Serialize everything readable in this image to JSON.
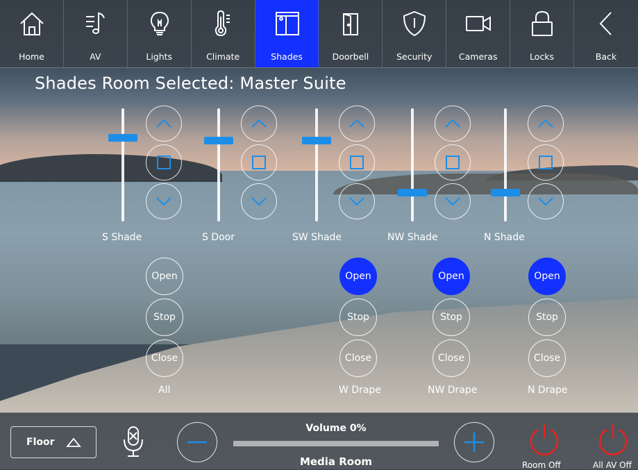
{
  "nav": {
    "items": [
      {
        "label": "Home",
        "icon": "home-icon"
      },
      {
        "label": "AV",
        "icon": "music-icon"
      },
      {
        "label": "Lights",
        "icon": "lightbulb-icon"
      },
      {
        "label": "Climate",
        "icon": "thermometer-icon"
      },
      {
        "label": "Shades",
        "icon": "shades-icon",
        "active": true
      },
      {
        "label": "Doorbell",
        "icon": "door-icon"
      },
      {
        "label": "Security",
        "icon": "shield-icon"
      },
      {
        "label": "Cameras",
        "icon": "camera-icon"
      },
      {
        "label": "Locks",
        "icon": "lock-icon"
      },
      {
        "label": "Back",
        "icon": "chevron-left-icon"
      }
    ]
  },
  "room_title": "Shades Room Selected: Master Suite",
  "shades": [
    {
      "label": "S Shade",
      "level": 0.74
    },
    {
      "label": "S Door",
      "level": 0.72
    },
    {
      "label": "SW Shade",
      "level": 0.72
    },
    {
      "label": "NW Shade",
      "level": 0.26
    },
    {
      "label": "N Shade",
      "level": 0.26
    }
  ],
  "drapes": [
    {
      "label": "All",
      "open_label": "Open",
      "stop_label": "Stop",
      "close_label": "Close",
      "open_active": false
    },
    {
      "label": "W Drape",
      "open_label": "Open",
      "stop_label": "Stop",
      "close_label": "Close",
      "open_active": true
    },
    {
      "label": "NW Drape",
      "open_label": "Open",
      "stop_label": "Stop",
      "close_label": "Close",
      "open_active": true
    },
    {
      "label": "N Drape",
      "open_label": "Open",
      "stop_label": "Stop",
      "close_label": "Close",
      "open_active": true
    }
  ],
  "bottom": {
    "floor_label": "Floor",
    "volume_label": "Volume 0%",
    "volume_level": 0,
    "room_name": "Media Room",
    "room_off_label": "Room Off",
    "all_av_off_label": "All AV Off"
  },
  "colors": {
    "accent": "#1330ff",
    "slider": "#1d8ee8",
    "power": "#e8231e"
  }
}
